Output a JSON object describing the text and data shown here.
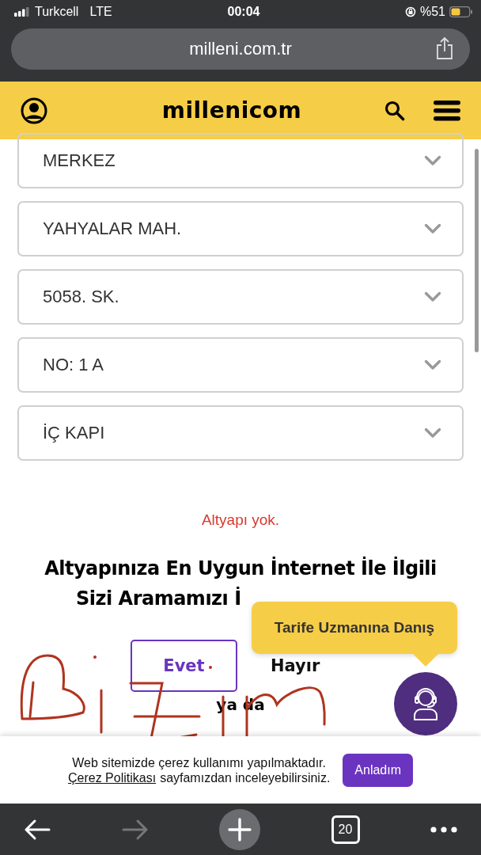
{
  "status_bar": {
    "carrier": "Turkcell",
    "network": "LTE",
    "time": "00:04",
    "battery_text": "%51"
  },
  "address_bar": {
    "url": "milleni.com.tr"
  },
  "header": {
    "logo": "millenicom"
  },
  "selects": [
    {
      "value": "MERKEZ"
    },
    {
      "value": "YAHYALAR MAH."
    },
    {
      "value": "5058. SK."
    },
    {
      "value": "NO: 1 A"
    },
    {
      "value": "İÇ KAPI"
    }
  ],
  "status_message": "Altyapı yok.",
  "question": {
    "line_1": "Altyapınıza En Uygun İnternet İle İlgili",
    "line_2": "Sizi Aramamızı İ"
  },
  "answers": [
    {
      "label": "Evet",
      "selected": true
    },
    {
      "label": "Hayır",
      "selected": false
    }
  ],
  "or_text": "ya da",
  "tooltip": "Tarife Uzmanına Danış",
  "cookie_banner": {
    "text_1": "Web sitemizde çerez kullanımı yapılmaktadır.",
    "link": "Çerez Politikası",
    "text_2": "sayfamızdan inceleyebilirsiniz.",
    "button": "Anladım"
  },
  "toolbar": {
    "tabs_count": "20",
    "forward_disabled": true
  }
}
